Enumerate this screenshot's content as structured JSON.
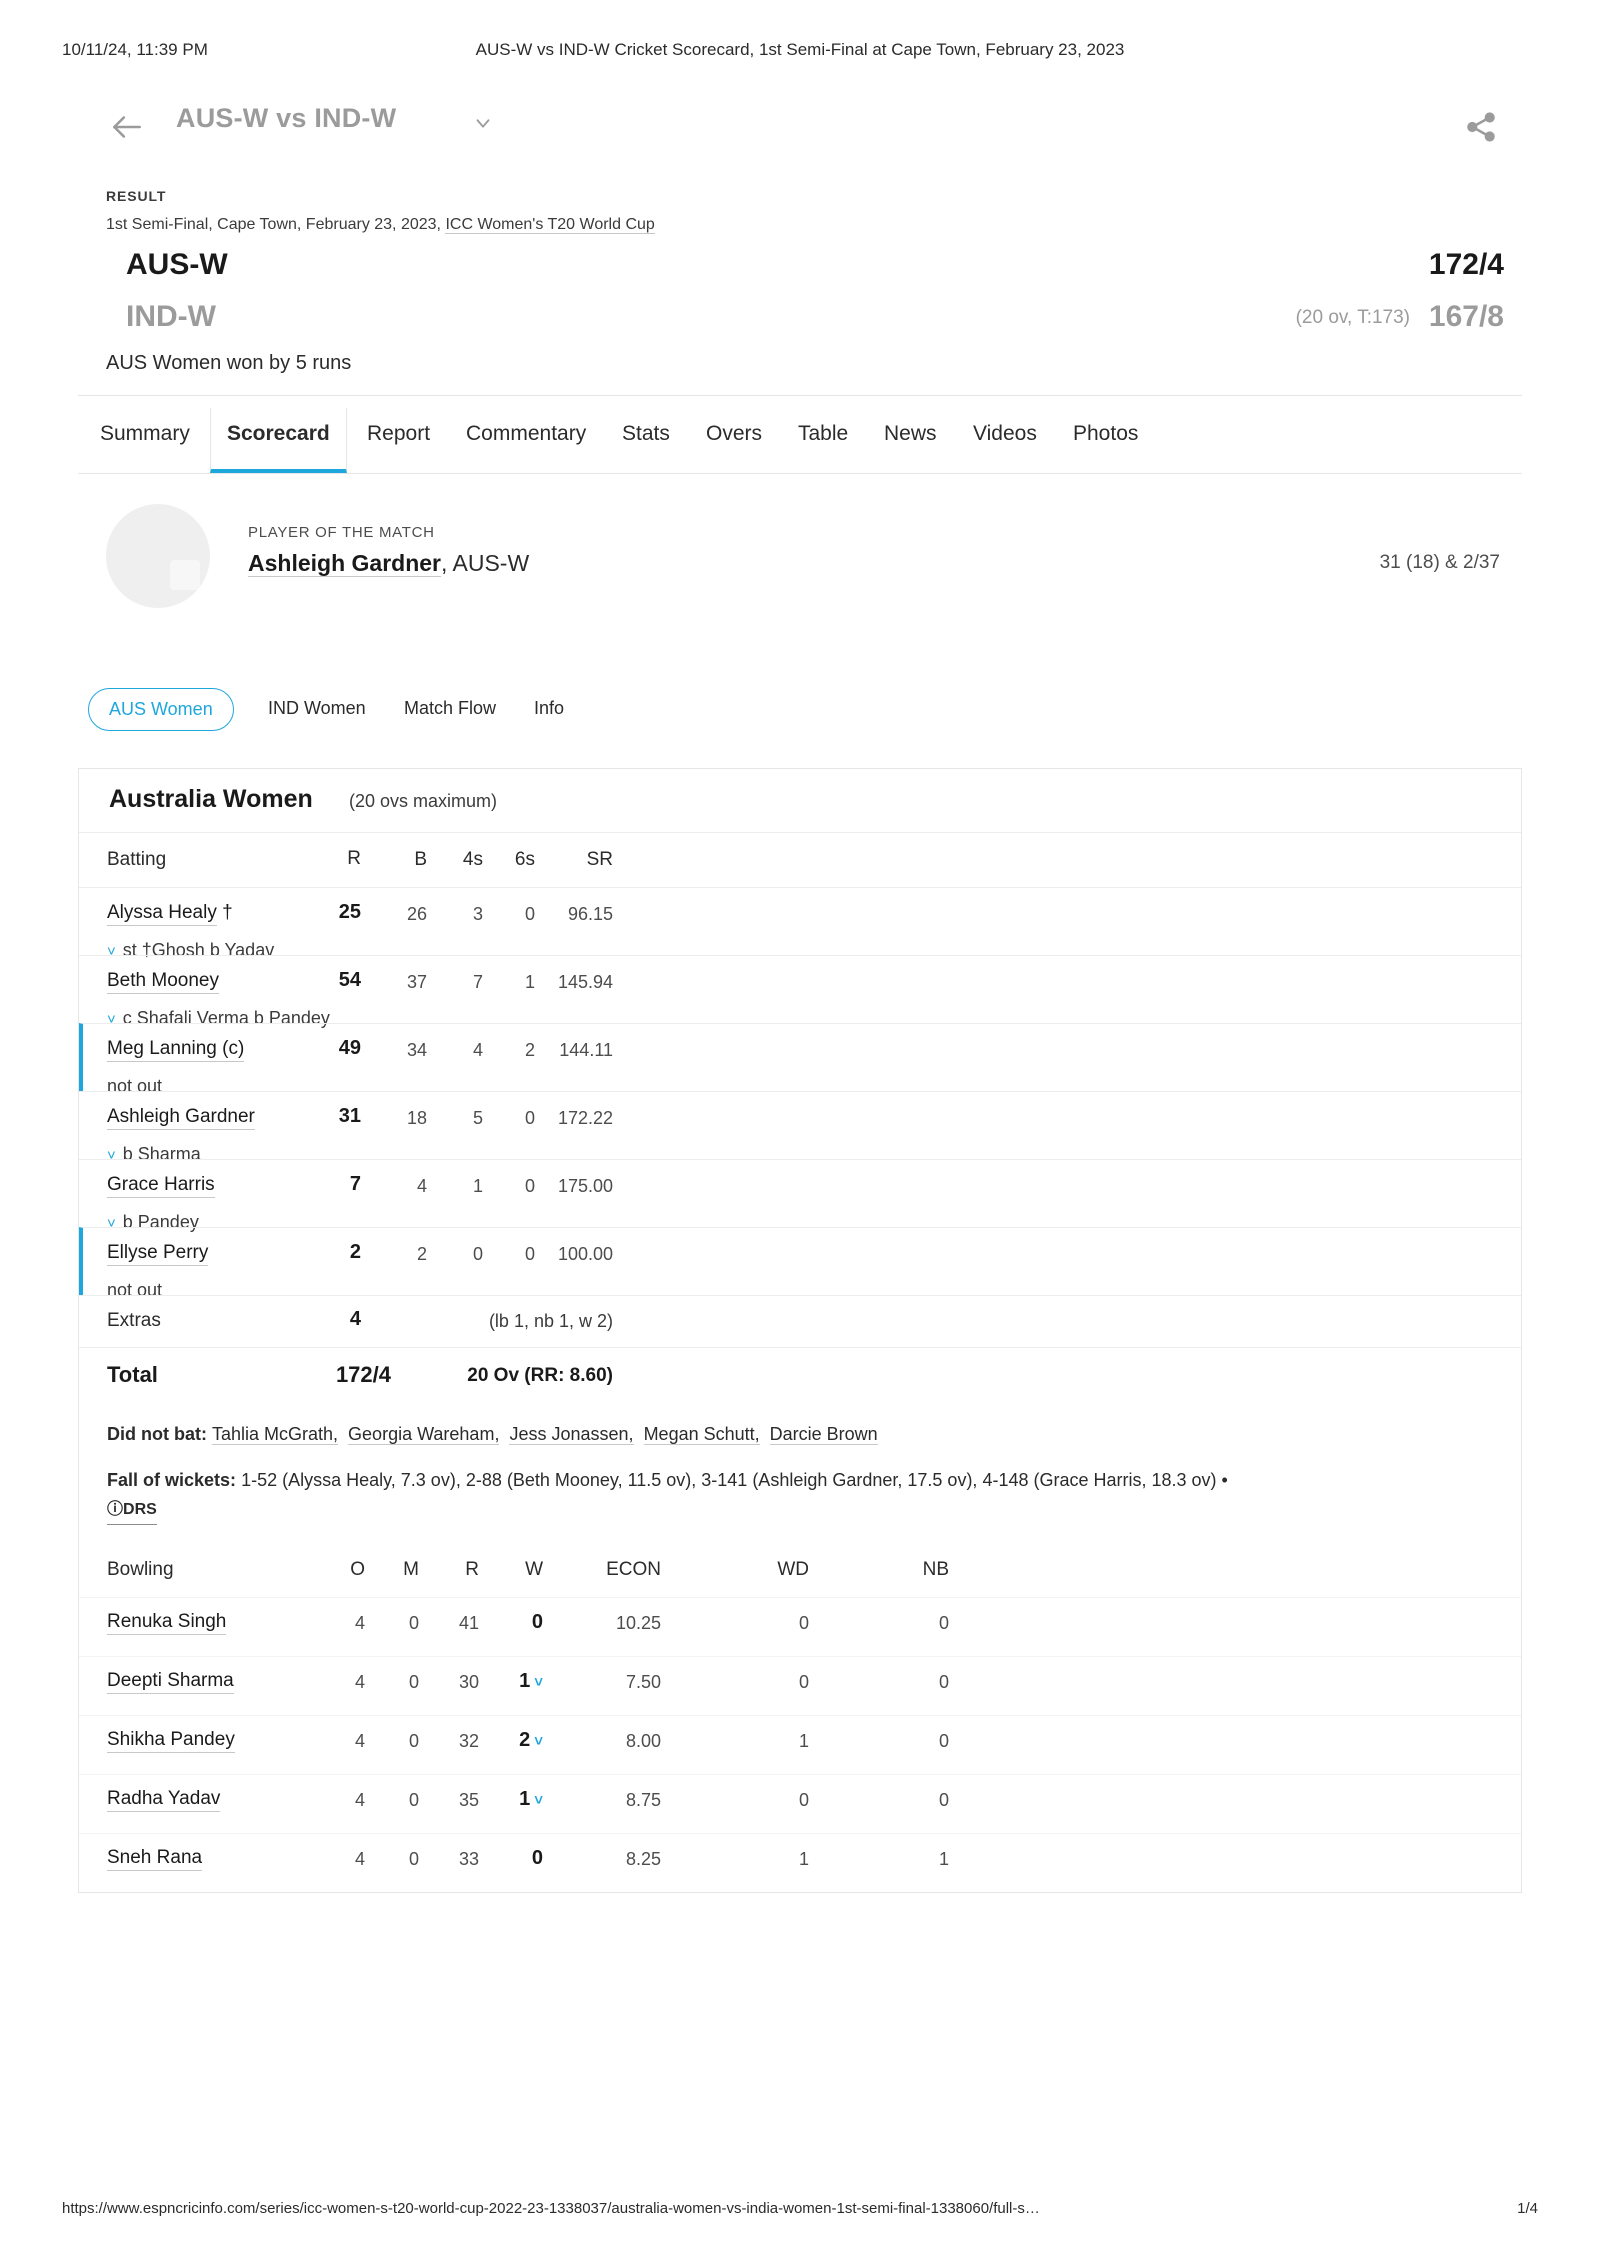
{
  "print": {
    "date": "10/11/24, 11:39 PM",
    "title": "AUS-W vs IND-W Cricket Scorecard, 1st Semi-Final at Cape Town, February 23, 2023",
    "url": "https://www.espncricinfo.com/series/icc-women-s-t20-world-cup-2022-23-1338037/australia-women-vs-india-women-1st-semi-final-1338060/full-s…",
    "page": "1/4"
  },
  "navbar": {
    "title": "AUS-W vs IND-W",
    "back_icon": "back-arrow-icon",
    "caret_icon": "chevron-down-icon",
    "share_icon": "share-icon"
  },
  "result": {
    "label": "RESULT",
    "subtitle_plain": "1st Semi-Final, Cape Town, February 23, 2023, ",
    "subtitle_link": "ICC Women's T20 World Cup",
    "teams": [
      {
        "name": "AUS-W",
        "overs": "",
        "score": "172/4"
      },
      {
        "name": "IND-W",
        "overs": "(20 ov, T:173)",
        "score": "167/8"
      }
    ],
    "message": "AUS Women won by 5 runs"
  },
  "tabs": [
    {
      "label": "Summary",
      "active": false
    },
    {
      "label": "Scorecard",
      "active": true
    },
    {
      "label": "Report",
      "active": false
    },
    {
      "label": "Commentary",
      "active": false
    },
    {
      "label": "Stats",
      "active": false
    },
    {
      "label": "Overs",
      "active": false
    },
    {
      "label": "Table",
      "active": false
    },
    {
      "label": "News",
      "active": false
    },
    {
      "label": "Videos",
      "active": false
    },
    {
      "label": "Photos",
      "active": false
    }
  ],
  "potm": {
    "label": "PLAYER OF THE MATCH",
    "name": "Ashleigh Gardner",
    "team": ", AUS-W",
    "figures": "31 (18) & 2/37"
  },
  "pills": [
    {
      "label": "AUS Women",
      "active": true
    },
    {
      "label": "IND Women",
      "active": false
    },
    {
      "label": "Match Flow",
      "active": false
    },
    {
      "label": "Info",
      "active": false
    }
  ],
  "scorecard": {
    "team": "Australia Women",
    "overs_note": "(20 ovs maximum)",
    "batting_header": {
      "name": "Batting",
      "r": "R",
      "b": "B",
      "fours": "4s",
      "sixes": "6s",
      "sr": "SR"
    },
    "batters": [
      {
        "name": "Alyssa Healy",
        "suffix": " †",
        "dismissal": "st †Ghosh b Yadav",
        "not_out": false,
        "r": "25",
        "b": "26",
        "fours": "3",
        "sixes": "0",
        "sr": "96.15"
      },
      {
        "name": "Beth Mooney",
        "suffix": "",
        "dismissal": "c Shafali Verma b Pandey",
        "not_out": false,
        "r": "54",
        "b": "37",
        "fours": "7",
        "sixes": "1",
        "sr": "145.94"
      },
      {
        "name": "Meg Lanning (c)",
        "suffix": "",
        "dismissal": "not out",
        "not_out": true,
        "r": "49",
        "b": "34",
        "fours": "4",
        "sixes": "2",
        "sr": "144.11"
      },
      {
        "name": "Ashleigh Gardner",
        "suffix": "",
        "dismissal": "b Sharma",
        "not_out": false,
        "r": "31",
        "b": "18",
        "fours": "5",
        "sixes": "0",
        "sr": "172.22"
      },
      {
        "name": "Grace Harris",
        "suffix": "",
        "dismissal": "b Pandey",
        "not_out": false,
        "r": "7",
        "b": "4",
        "fours": "1",
        "sixes": "0",
        "sr": "175.00"
      },
      {
        "name": "Ellyse Perry",
        "suffix": "",
        "dismissal": "not out",
        "not_out": true,
        "r": "2",
        "b": "2",
        "fours": "0",
        "sixes": "0",
        "sr": "100.00"
      }
    ],
    "extras": {
      "label": "Extras",
      "value": "4",
      "detail": "(lb 1, nb 1, w 2)"
    },
    "total": {
      "label": "Total",
      "value": "172/4",
      "detail": "20 Ov (RR: 8.60)"
    },
    "did_not_bat": {
      "label": "Did not bat:",
      "players": [
        "Tahlia McGrath,",
        "Georgia Wareham,",
        "Jess Jonassen,",
        "Megan Schutt,",
        "Darcie Brown"
      ]
    },
    "fall_of_wickets": {
      "label": "Fall of wickets:",
      "text": "1-52 (Alyssa Healy, 7.3 ov), 2-88 (Beth Mooney, 11.5 ov), 3-141 (Ashleigh Gardner, 17.5 ov), 4-148 (Grace Harris, 18.3 ov) •",
      "drs": "DRS"
    },
    "bowling_header": {
      "name": "Bowling",
      "o": "O",
      "m": "M",
      "r": "R",
      "w": "W",
      "econ": "ECON",
      "wd": "WD",
      "nb": "NB"
    },
    "bowlers": [
      {
        "name": "Renuka Singh",
        "o": "4",
        "m": "0",
        "r": "41",
        "w": "0",
        "w_chev": false,
        "econ": "10.25",
        "wd": "0",
        "nb": "0"
      },
      {
        "name": "Deepti Sharma",
        "o": "4",
        "m": "0",
        "r": "30",
        "w": "1",
        "w_chev": true,
        "econ": "7.50",
        "wd": "0",
        "nb": "0"
      },
      {
        "name": "Shikha Pandey",
        "o": "4",
        "m": "0",
        "r": "32",
        "w": "2",
        "w_chev": true,
        "econ": "8.00",
        "wd": "1",
        "nb": "0"
      },
      {
        "name": "Radha Yadav",
        "o": "4",
        "m": "0",
        "r": "35",
        "w": "1",
        "w_chev": true,
        "econ": "8.75",
        "wd": "0",
        "nb": "0"
      },
      {
        "name": "Sneh Rana",
        "o": "4",
        "m": "0",
        "r": "33",
        "w": "0",
        "w_chev": false,
        "econ": "8.25",
        "wd": "1",
        "nb": "1"
      }
    ]
  },
  "colors": {
    "accent": "#1ea7dd",
    "muted": "#9b9b9b",
    "border": "#e6e6e6"
  }
}
